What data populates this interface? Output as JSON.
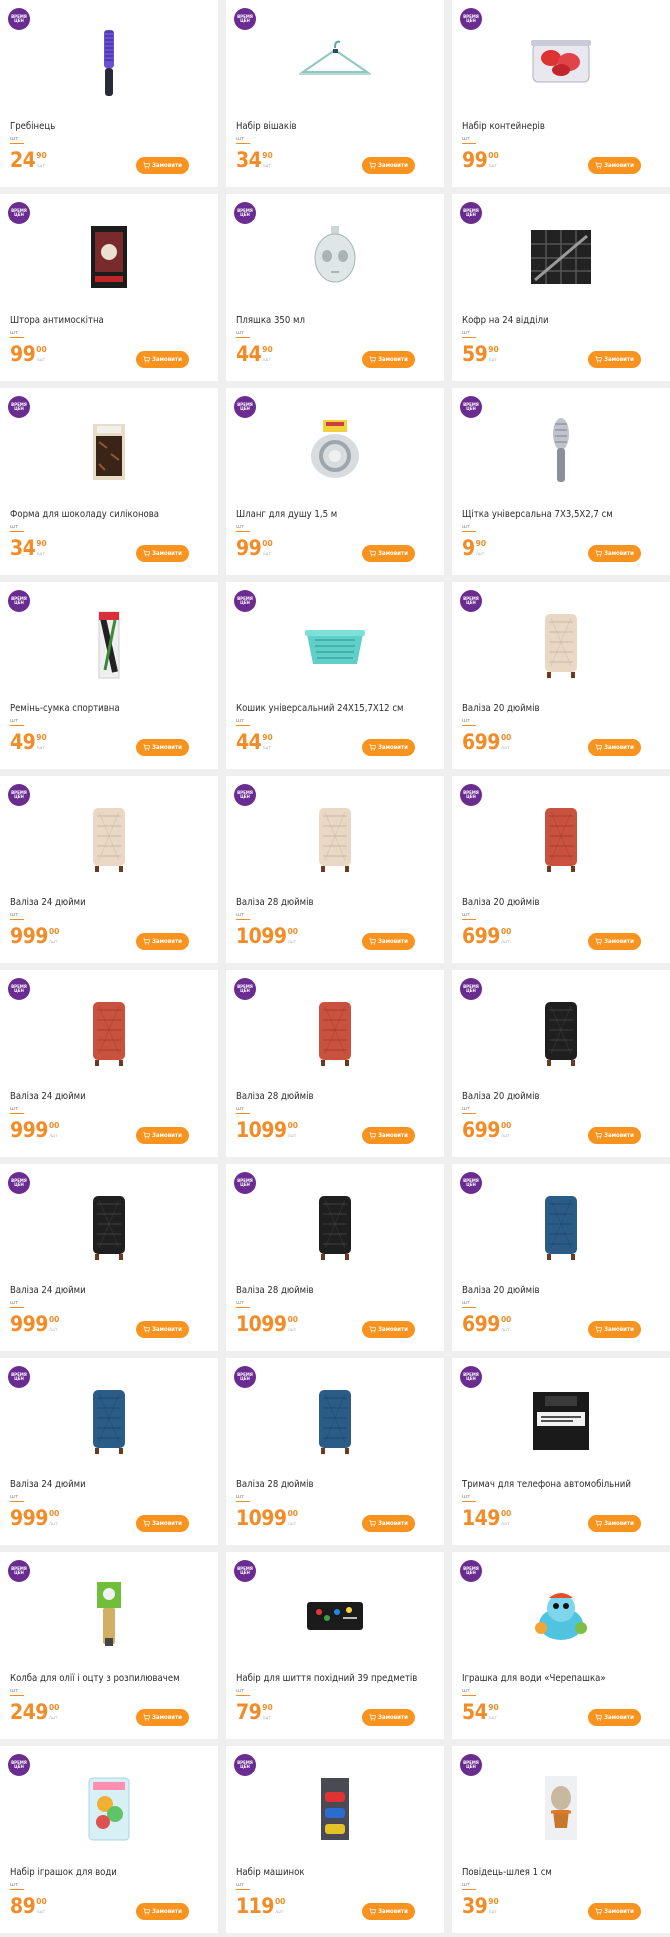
{
  "badge_text": "ВРЕМЯ ЦЕН",
  "unit_label": "шт",
  "per_unit_label": "/шт",
  "order_label": "Замовити",
  "colors": {
    "accent": "#f28c28",
    "button": "#f7931e",
    "badge": "#6a2c91"
  },
  "products": [
    {
      "title": "Гребінець",
      "price_int": "24",
      "price_dec": "90",
      "image": "comb"
    },
    {
      "title": "Набір вішаків",
      "price_int": "34",
      "price_dec": "90",
      "image": "hanger"
    },
    {
      "title": "Набір контейнерів",
      "price_int": "99",
      "price_dec": "00",
      "image": "containers"
    },
    {
      "title": "Штора антимоскітна",
      "price_int": "99",
      "price_dec": "00",
      "image": "curtain-box"
    },
    {
      "title": "Пляшка 350 мл",
      "price_int": "44",
      "price_dec": "90",
      "image": "skull-bottle"
    },
    {
      "title": "Кофр на 24 відділи",
      "price_int": "59",
      "price_dec": "90",
      "image": "organizer"
    },
    {
      "title": "Форма для шоколаду силіконова",
      "price_int": "34",
      "price_dec": "90",
      "image": "chocolate-mold"
    },
    {
      "title": "Шланг для душу 1,5 м",
      "price_int": "99",
      "price_dec": "00",
      "image": "shower-hose"
    },
    {
      "title": "Щітка універсальна 7Х3,5Х2,7 см",
      "price_int": "9",
      "price_dec": "90",
      "image": "brush"
    },
    {
      "title": "Ремінь-сумка спортивна",
      "price_int": "49",
      "price_dec": "90",
      "image": "belt-bag"
    },
    {
      "title": "Кошик універсальний 24Х15,7Х12 см",
      "price_int": "44",
      "price_dec": "90",
      "image": "basket"
    },
    {
      "title": "Валіза 20 дюймів",
      "price_int": "699",
      "price_dec": "00",
      "image": "suitcase-beige"
    },
    {
      "title": "Валіза 24 дюйми",
      "price_int": "999",
      "price_dec": "00",
      "image": "suitcase-beige"
    },
    {
      "title": "Валіза 28 дюймів",
      "price_int": "1099",
      "price_dec": "00",
      "image": "suitcase-beige"
    },
    {
      "title": "Валіза 20 дюймів",
      "price_int": "699",
      "price_dec": "00",
      "image": "suitcase-red"
    },
    {
      "title": "Валіза 24 дюйми",
      "price_int": "999",
      "price_dec": "00",
      "image": "suitcase-red"
    },
    {
      "title": "Валіза 28 дюймів",
      "price_int": "1099",
      "price_dec": "00",
      "image": "suitcase-red"
    },
    {
      "title": "Валіза 20 дюймів",
      "price_int": "699",
      "price_dec": "00",
      "image": "suitcase-black"
    },
    {
      "title": "Валіза 24 дюйми",
      "price_int": "999",
      "price_dec": "00",
      "image": "suitcase-black"
    },
    {
      "title": "Валіза 28 дюймів",
      "price_int": "1099",
      "price_dec": "00",
      "image": "suitcase-black"
    },
    {
      "title": "Валіза 20 дюймів",
      "price_int": "699",
      "price_dec": "00",
      "image": "suitcase-blue"
    },
    {
      "title": "Валіза 24 дюйми",
      "price_int": "999",
      "price_dec": "00",
      "image": "suitcase-blue"
    },
    {
      "title": "Валіза 28 дюймів",
      "price_int": "1099",
      "price_dec": "00",
      "image": "suitcase-blue"
    },
    {
      "title": "Тримач для телефона автомобільний",
      "price_int": "149",
      "price_dec": "00",
      "image": "phone-holder-box"
    },
    {
      "title": "Колба для олії і оцту з розпилювачем",
      "price_int": "249",
      "price_dec": "00",
      "image": "oil-sprayer"
    },
    {
      "title": "Набір для шиття похідний 39 предметів",
      "price_int": "79",
      "price_dec": "90",
      "image": "sewing-kit"
    },
    {
      "title": "Іграшка для води «Черепашка»",
      "price_int": "54",
      "price_dec": "90",
      "image": "turtle-toy"
    },
    {
      "title": "Набір іграшок для води",
      "price_int": "89",
      "price_dec": "00",
      "image": "bath-toys"
    },
    {
      "title": "Набір машинок",
      "price_int": "119",
      "price_dec": "00",
      "image": "toy-cars"
    },
    {
      "title": "Повідець-шлея 1 см",
      "price_int": "39",
      "price_dec": "90",
      "image": "pet-harness"
    }
  ]
}
